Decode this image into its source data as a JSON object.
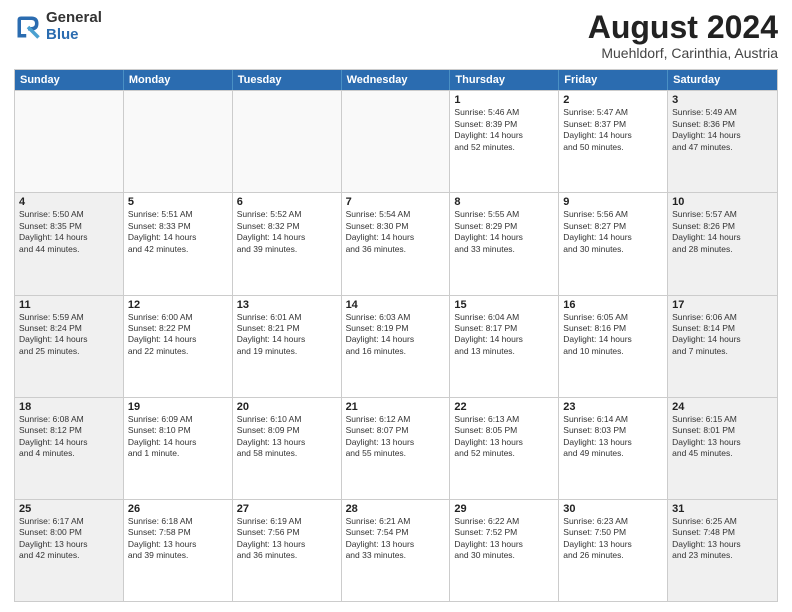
{
  "header": {
    "logo_line1": "General",
    "logo_line2": "Blue",
    "title": "August 2024",
    "subtitle": "Muehldorf, Carinthia, Austria"
  },
  "weekdays": [
    "Sunday",
    "Monday",
    "Tuesday",
    "Wednesday",
    "Thursday",
    "Friday",
    "Saturday"
  ],
  "weeks": [
    [
      {
        "day": "",
        "info": "",
        "empty": true
      },
      {
        "day": "",
        "info": "",
        "empty": true
      },
      {
        "day": "",
        "info": "",
        "empty": true
      },
      {
        "day": "",
        "info": "",
        "empty": true
      },
      {
        "day": "1",
        "info": "Sunrise: 5:46 AM\nSunset: 8:39 PM\nDaylight: 14 hours\nand 52 minutes.",
        "empty": false
      },
      {
        "day": "2",
        "info": "Sunrise: 5:47 AM\nSunset: 8:37 PM\nDaylight: 14 hours\nand 50 minutes.",
        "empty": false
      },
      {
        "day": "3",
        "info": "Sunrise: 5:49 AM\nSunset: 8:36 PM\nDaylight: 14 hours\nand 47 minutes.",
        "empty": false
      }
    ],
    [
      {
        "day": "4",
        "info": "Sunrise: 5:50 AM\nSunset: 8:35 PM\nDaylight: 14 hours\nand 44 minutes.",
        "empty": false
      },
      {
        "day": "5",
        "info": "Sunrise: 5:51 AM\nSunset: 8:33 PM\nDaylight: 14 hours\nand 42 minutes.",
        "empty": false
      },
      {
        "day": "6",
        "info": "Sunrise: 5:52 AM\nSunset: 8:32 PM\nDaylight: 14 hours\nand 39 minutes.",
        "empty": false
      },
      {
        "day": "7",
        "info": "Sunrise: 5:54 AM\nSunset: 8:30 PM\nDaylight: 14 hours\nand 36 minutes.",
        "empty": false
      },
      {
        "day": "8",
        "info": "Sunrise: 5:55 AM\nSunset: 8:29 PM\nDaylight: 14 hours\nand 33 minutes.",
        "empty": false
      },
      {
        "day": "9",
        "info": "Sunrise: 5:56 AM\nSunset: 8:27 PM\nDaylight: 14 hours\nand 30 minutes.",
        "empty": false
      },
      {
        "day": "10",
        "info": "Sunrise: 5:57 AM\nSunset: 8:26 PM\nDaylight: 14 hours\nand 28 minutes.",
        "empty": false
      }
    ],
    [
      {
        "day": "11",
        "info": "Sunrise: 5:59 AM\nSunset: 8:24 PM\nDaylight: 14 hours\nand 25 minutes.",
        "empty": false
      },
      {
        "day": "12",
        "info": "Sunrise: 6:00 AM\nSunset: 8:22 PM\nDaylight: 14 hours\nand 22 minutes.",
        "empty": false
      },
      {
        "day": "13",
        "info": "Sunrise: 6:01 AM\nSunset: 8:21 PM\nDaylight: 14 hours\nand 19 minutes.",
        "empty": false
      },
      {
        "day": "14",
        "info": "Sunrise: 6:03 AM\nSunset: 8:19 PM\nDaylight: 14 hours\nand 16 minutes.",
        "empty": false
      },
      {
        "day": "15",
        "info": "Sunrise: 6:04 AM\nSunset: 8:17 PM\nDaylight: 14 hours\nand 13 minutes.",
        "empty": false
      },
      {
        "day": "16",
        "info": "Sunrise: 6:05 AM\nSunset: 8:16 PM\nDaylight: 14 hours\nand 10 minutes.",
        "empty": false
      },
      {
        "day": "17",
        "info": "Sunrise: 6:06 AM\nSunset: 8:14 PM\nDaylight: 14 hours\nand 7 minutes.",
        "empty": false
      }
    ],
    [
      {
        "day": "18",
        "info": "Sunrise: 6:08 AM\nSunset: 8:12 PM\nDaylight: 14 hours\nand 4 minutes.",
        "empty": false
      },
      {
        "day": "19",
        "info": "Sunrise: 6:09 AM\nSunset: 8:10 PM\nDaylight: 14 hours\nand 1 minute.",
        "empty": false
      },
      {
        "day": "20",
        "info": "Sunrise: 6:10 AM\nSunset: 8:09 PM\nDaylight: 13 hours\nand 58 minutes.",
        "empty": false
      },
      {
        "day": "21",
        "info": "Sunrise: 6:12 AM\nSunset: 8:07 PM\nDaylight: 13 hours\nand 55 minutes.",
        "empty": false
      },
      {
        "day": "22",
        "info": "Sunrise: 6:13 AM\nSunset: 8:05 PM\nDaylight: 13 hours\nand 52 minutes.",
        "empty": false
      },
      {
        "day": "23",
        "info": "Sunrise: 6:14 AM\nSunset: 8:03 PM\nDaylight: 13 hours\nand 49 minutes.",
        "empty": false
      },
      {
        "day": "24",
        "info": "Sunrise: 6:15 AM\nSunset: 8:01 PM\nDaylight: 13 hours\nand 45 minutes.",
        "empty": false
      }
    ],
    [
      {
        "day": "25",
        "info": "Sunrise: 6:17 AM\nSunset: 8:00 PM\nDaylight: 13 hours\nand 42 minutes.",
        "empty": false
      },
      {
        "day": "26",
        "info": "Sunrise: 6:18 AM\nSunset: 7:58 PM\nDaylight: 13 hours\nand 39 minutes.",
        "empty": false
      },
      {
        "day": "27",
        "info": "Sunrise: 6:19 AM\nSunset: 7:56 PM\nDaylight: 13 hours\nand 36 minutes.",
        "empty": false
      },
      {
        "day": "28",
        "info": "Sunrise: 6:21 AM\nSunset: 7:54 PM\nDaylight: 13 hours\nand 33 minutes.",
        "empty": false
      },
      {
        "day": "29",
        "info": "Sunrise: 6:22 AM\nSunset: 7:52 PM\nDaylight: 13 hours\nand 30 minutes.",
        "empty": false
      },
      {
        "day": "30",
        "info": "Sunrise: 6:23 AM\nSunset: 7:50 PM\nDaylight: 13 hours\nand 26 minutes.",
        "empty": false
      },
      {
        "day": "31",
        "info": "Sunrise: 6:25 AM\nSunset: 7:48 PM\nDaylight: 13 hours\nand 23 minutes.",
        "empty": false
      }
    ]
  ]
}
